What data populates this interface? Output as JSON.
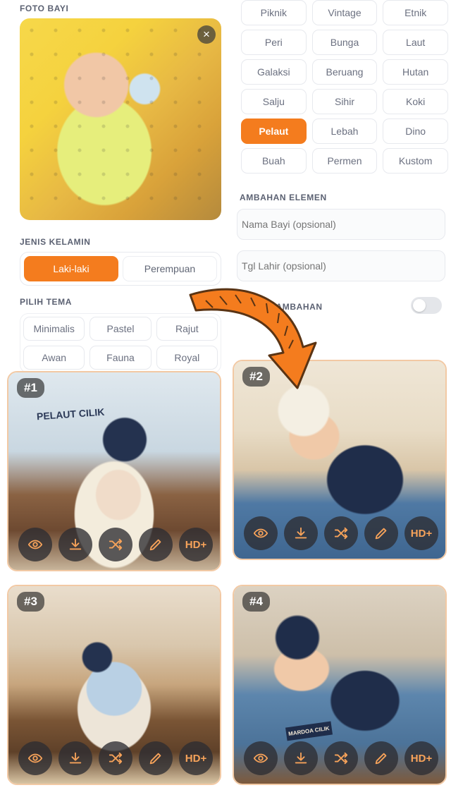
{
  "form": {
    "photo_label": "FOTO BAYI",
    "close_symbol": "×",
    "gender_label": "JENIS KELAMIN",
    "gender_options": [
      "Laki-laki",
      "Perempuan"
    ],
    "gender_selected": "Laki-laki",
    "theme_label": "PILIH TEMA",
    "themes_left": [
      "Minimalis",
      "Pastel",
      "Rajut",
      "Awan",
      "Fauna",
      "Royal"
    ],
    "themes_right": [
      "Piknik",
      "Vintage",
      "Etnik",
      "Peri",
      "Bunga",
      "Laut",
      "Galaksi",
      "Beruang",
      "Hutan",
      "Salju",
      "Sihir",
      "Koki",
      "Pelaut",
      "Lebah",
      "Dino",
      "Buah",
      "Permen",
      "Kustom"
    ],
    "theme_selected": "Pelaut",
    "extra_label": "AMBAHAN ELEMEN",
    "baby_name_placeholder": "Nama Bayi (opsional)",
    "birth_date_placeholder": "Tgl Lahir (opsional)",
    "option_label": "SI TAMBAHAN",
    "option_enabled": false
  },
  "results": [
    {
      "badge": "#1",
      "sign": "PELAUT CILIK"
    },
    {
      "badge": "#2"
    },
    {
      "badge": "#3"
    },
    {
      "badge": "#4",
      "sign": "MARDOA CILIK"
    }
  ],
  "card_actions": [
    "eye-icon",
    "download-icon",
    "shuffle-icon",
    "pencil-icon",
    "HD+"
  ],
  "colors": {
    "accent": "#f47c1e",
    "card_border": "#f2c9a4",
    "action_bg": "#2d2d32"
  }
}
